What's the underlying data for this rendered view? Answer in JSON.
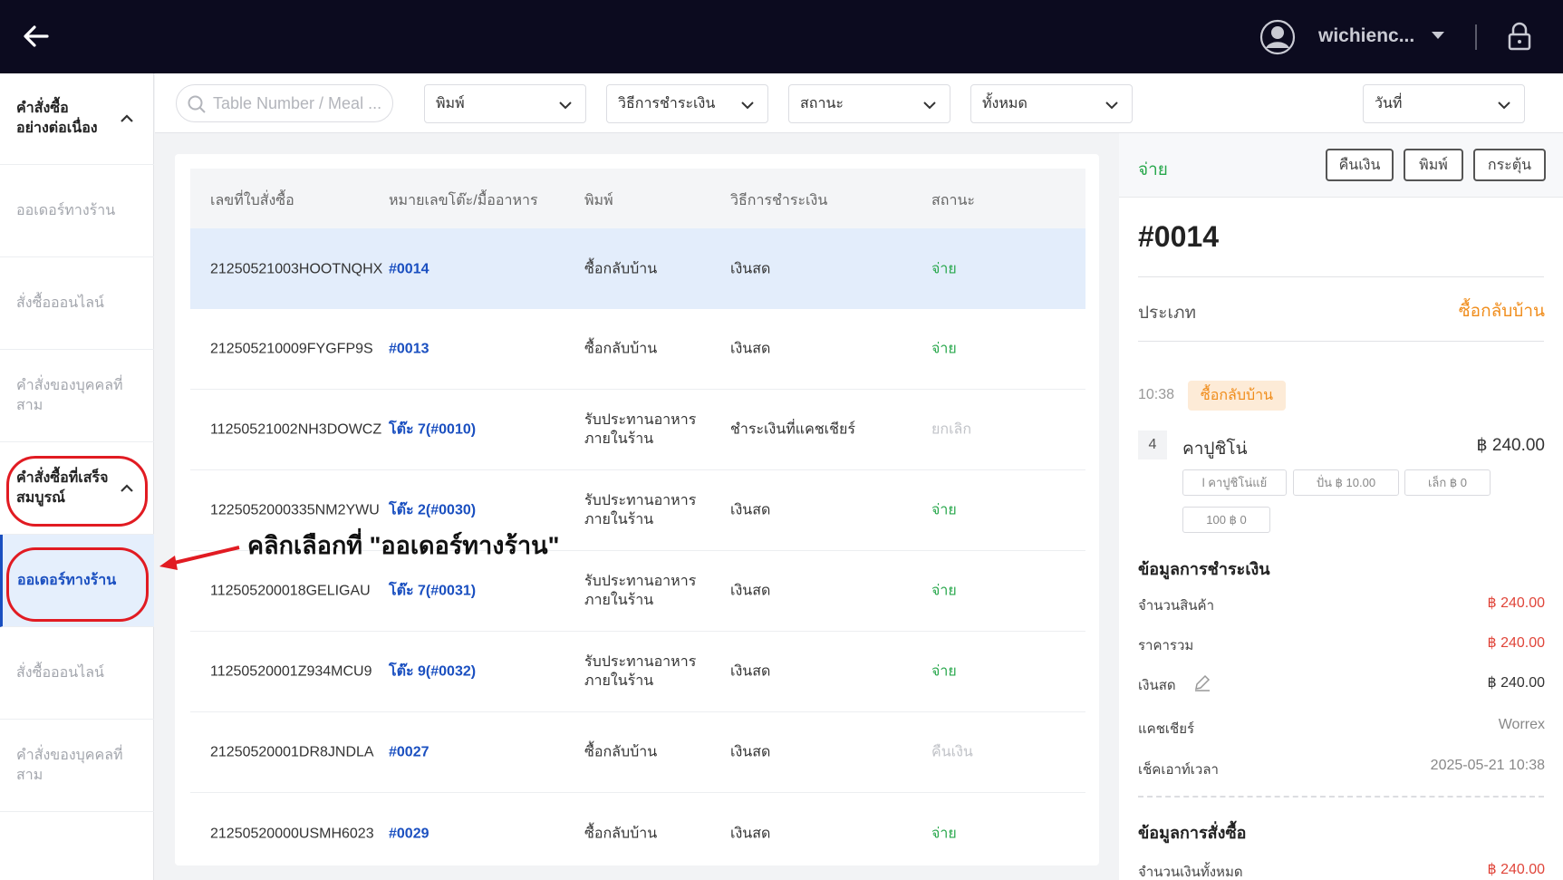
{
  "header": {
    "username": "wichienc...",
    "icons": {
      "back": "arrow-left-icon",
      "avatar": "user-circle-icon",
      "caret": "caret-down-icon",
      "lock": "lock-icon"
    }
  },
  "sidebar": {
    "groups": [
      {
        "label": "คำสั่งซื้ออย่างต่อเนื่อง",
        "items": [
          "ออเดอร์ทางร้าน",
          "สั่งซื้อออนไลน์",
          "คำสั่งของบุคคลที่สาม"
        ]
      },
      {
        "label": "คำสั่งซื้อที่เสร็จสมบูรณ์",
        "items": [
          "ออเดอร์ทางร้าน",
          "สั่งซื้อออนไลน์",
          "คำสั่งของบุคคลที่สาม"
        ]
      }
    ]
  },
  "filters": {
    "search_placeholder": "Table Number / Meal ...",
    "type": "พิมพ์",
    "payment": "วิธีการชำระเงิน",
    "status": "สถานะ",
    "all": "ทั้งหมด",
    "date": "วันที่"
  },
  "table": {
    "headers": [
      "เลขที่ใบสั่งซื้อ",
      "หมายเลขโต๊ะ/มื้ออาหาร",
      "พิมพ์",
      "วิธีการชำระเงิน",
      "สถานะ"
    ],
    "rows": [
      {
        "id": "21250521003HOOTNQHX",
        "table": "#0014",
        "type": "ซื้อกลับบ้าน",
        "payment": "เงินสด",
        "status": "จ่าย"
      },
      {
        "id": "212505210009FYGFP9S",
        "table": "#0013",
        "type": "ซื้อกลับบ้าน",
        "payment": "เงินสด",
        "status": "จ่าย"
      },
      {
        "id": "11250521002NH3DOWCZ",
        "table": "โต๊ะ 7(#0010)",
        "type": "รับประทานอาหารภายในร้าน",
        "payment": "ชำระเงินที่แคชเชียร์",
        "status": "ยกเลิก"
      },
      {
        "id": "1225052000335NM2YWU",
        "table": "โต๊ะ 2(#0030)",
        "type": "รับประทานอาหารภายในร้าน",
        "payment": "เงินสด",
        "status": "จ่าย"
      },
      {
        "id": "112505200018GELIGAU",
        "table": "โต๊ะ 7(#0031)",
        "type": "รับประทานอาหารภายในร้าน",
        "payment": "เงินสด",
        "status": "จ่าย"
      },
      {
        "id": "11250520001Z934MCU9",
        "table": "โต๊ะ 9(#0032)",
        "type": "รับประทานอาหารภายในร้าน",
        "payment": "เงินสด",
        "status": "จ่าย"
      },
      {
        "id": "21250520001DR8JNDLA",
        "table": "#0027",
        "type": "ซื้อกลับบ้าน",
        "payment": "เงินสด",
        "status": "คืนเงิน"
      },
      {
        "id": "21250520000USMH6023",
        "table": "#0029",
        "type": "ซื้อกลับบ้าน",
        "payment": "เงินสด",
        "status": "จ่าย"
      }
    ]
  },
  "detail": {
    "status": "จ่าย",
    "buttons": {
      "refund": "คืนเงิน",
      "print": "พิมพ์",
      "trigger": "กระตุ้น"
    },
    "order_number": "#0014",
    "type_label": "ประเภท",
    "type_value": "ซื้อกลับบ้าน",
    "time": "10:38",
    "badge": "ซื้อกลับบ้าน",
    "item": {
      "qty": "4",
      "name": "คาปูชิโน่",
      "price": "฿ 240.00",
      "tags": [
        "l คาปูชิโน่แย้",
        "ปั่น ฿ 10.00",
        "เล็ก ฿ 0",
        "100 ฿ 0"
      ]
    },
    "payment_title": "ข้อมูลการชำระเงิน",
    "payment_rows": [
      {
        "label": "จำนวนสินค้า",
        "value": "฿ 240.00"
      },
      {
        "label": "ราคารวม",
        "value": "฿ 240.00"
      },
      {
        "label": "เงินสด",
        "value": "฿ 240.00"
      },
      {
        "label": "แคชเชียร์",
        "value": "Worrex"
      },
      {
        "label": "เช็คเอาท์เวลา",
        "value": "2025-05-21 10:38"
      }
    ],
    "order_title": "ข้อมูลการสั่งซื้อ",
    "order_rows": [
      {
        "label": "จำนวนเงินทั้งหมด",
        "value": "฿ 240.00"
      }
    ]
  },
  "annotation": {
    "text": "คลิกเลือกที่ \"ออเดอร์ทางร้าน\""
  },
  "colors": {
    "topbar": "#0c0b1f",
    "accent_blue": "#1a4fc0",
    "paid_green": "#27a74b",
    "orange": "#f08c1a",
    "annotation_red": "#e11b22"
  }
}
